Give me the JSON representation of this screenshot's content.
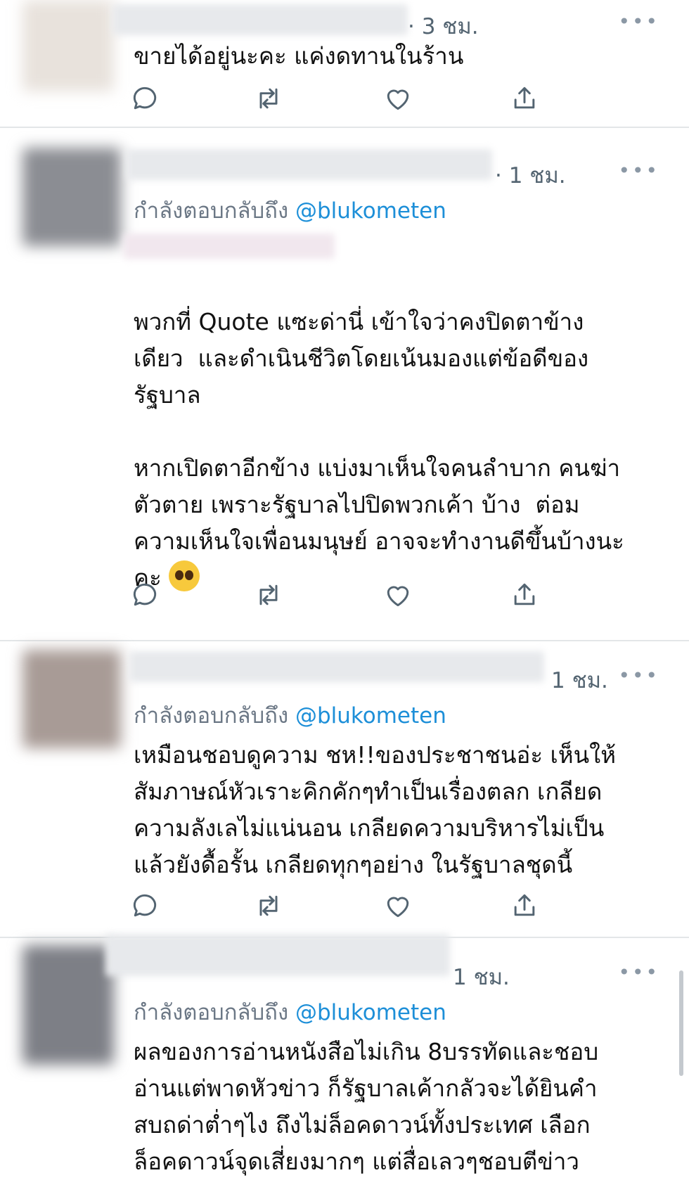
{
  "tweets": [
    {
      "time": "· 3 ชม.",
      "replying_prefix": "",
      "handle": "",
      "text": "ขายได้อยู่นะคะ แค่งดทานในร้าน",
      "more": "•••"
    },
    {
      "time": "· 1 ชม.",
      "replying_prefix": "กำลังตอบกลับถึง ",
      "handle": "@blukometen",
      "text": "พวกที่ Quote แซะด่านี่ เข้าใจว่าคงปิดตาข้าง\nเดียว  และดำเนินชีวิตโดยเน้นมองแต่ข้อดีของ\nรัฐบาล\n\nหากเปิดตาอีกข้าง แบ่งมาเห็นใจคนลำบาก คนฆ่า\nตัวตาย เพราะรัฐบาลไปปิดพวกเค้า บ้าง  ต่อม\nความเห็นใจเพื่อนมนุษย์ อาจจะทำงานดีขึ้นบ้างนะ\nคะ",
      "emoji": "pleading-face",
      "more": "•••"
    },
    {
      "time": "1 ชม.",
      "replying_prefix": "กำลังตอบกลับถึง ",
      "handle": "@blukometen",
      "text": "เหมือนชอบดูความ ชห!!ของประชาชนอ่ะ เห็นให้\nสัมภาษณ์หัวเราะคิกคักๆทำเป็นเรื่องตลก เกลียด\nความลังเลไม่แน่นอน เกลียดความบริหารไม่เป็น\nแล้วยังดื้อรั้น เกลียดทุกๆอย่าง ในรัฐบาลชุดนี้",
      "more": "•••"
    },
    {
      "time": "1 ชม.",
      "replying_prefix": "กำลังตอบกลับถึง ",
      "handle": "@blukometen",
      "text": "ผลของการอ่านหนังสือไม่เกิน 8บรรทัดและชอบ\nอ่านแต่พาดหัวข่าว ก็รัฐบาลเค้ากลัวจะได้ยินคำ\nสบถด่าต่ำๆไง ถึงไม่ล็อคดาวน์ทั้งประเทศ เลือก\nล็อคดาวน์จุดเสี่ยงมากๆ แต่สื่อเลวๆชอบตีข่าว",
      "more": "•••"
    }
  ],
  "icons": {
    "reply": "reply-icon",
    "retweet": "retweet-icon",
    "like": "heart-icon",
    "share": "share-icon"
  },
  "colors": {
    "handle": "#1d8fd8",
    "secondary_text": "#6b7785",
    "icon": "#536471",
    "divider": "#e3e6e8"
  }
}
